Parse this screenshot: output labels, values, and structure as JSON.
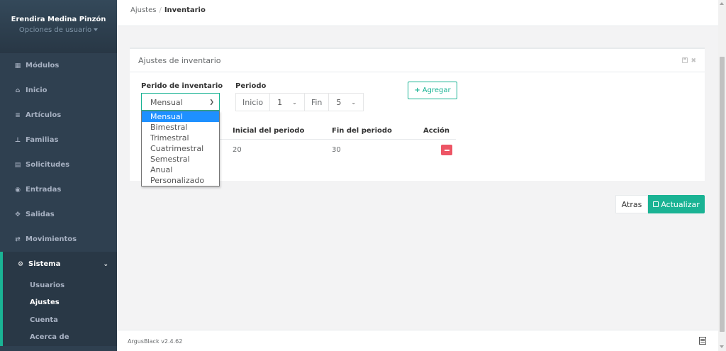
{
  "user": {
    "name": "Erendira Medina Pinzón",
    "options": "Opciones de usuario"
  },
  "sidebar": {
    "items": [
      {
        "label": "Módulos",
        "icon": "grid-icon"
      },
      {
        "label": "Inicio",
        "icon": "home-icon"
      },
      {
        "label": "Artículos",
        "icon": "list-icon"
      },
      {
        "label": "Familias",
        "icon": "sitemap-icon"
      },
      {
        "label": "Solicitudes",
        "icon": "file-icon"
      },
      {
        "label": "Entradas",
        "icon": "eye-icon"
      },
      {
        "label": "Salidas",
        "icon": "handshake-icon"
      },
      {
        "label": "Movimientos",
        "icon": "exchange-icon"
      }
    ],
    "active": {
      "label": "Sistema",
      "icon": "cogs-icon"
    },
    "submenu": [
      "Usuarios",
      "Ajustes",
      "Cuenta",
      "Acerca de"
    ]
  },
  "breadcrumb": {
    "parent": "Ajustes",
    "current": "Inventario"
  },
  "panel": {
    "title": "Ajustes de inventario",
    "periodo_inventario_label": "Perido de inventario",
    "periodo_label": "Periodo",
    "selected_period": "Mensual",
    "dropdown_options": [
      "Mensual",
      "Bimestral",
      "Trimestral",
      "Cuatrimestral",
      "Semestral",
      "Anual",
      "Personalizado"
    ],
    "inicio_label": "Inicio",
    "inicio_value": "1",
    "fin_label": "Fin",
    "fin_value": "5",
    "add_label": "Agregar",
    "table": {
      "headers": [
        "Inicial del periodo",
        "Fin del periodo",
        "Acción"
      ],
      "rows": [
        {
          "inicial": "20",
          "fin": "30"
        }
      ]
    }
  },
  "actions": {
    "back": "Atras",
    "update": "Actualizar"
  },
  "footer": {
    "version": "ArgusBlack v2.4.62"
  },
  "colors": {
    "sidebar": "#2f4050",
    "accent": "#1ab394",
    "danger": "#ed5565",
    "highlight": "#1e90ff"
  }
}
